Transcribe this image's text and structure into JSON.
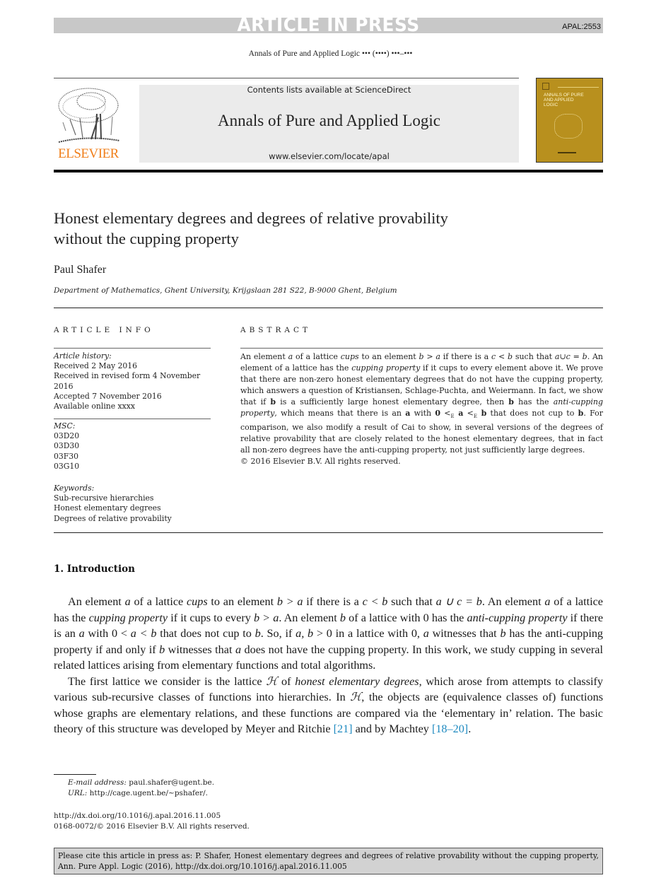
{
  "banner": {
    "title": "ARTICLE IN PRESS",
    "code": "APAL:2553"
  },
  "running_head": "Annals of Pure and Applied Logic ••• (••••) •••–•••",
  "masthead": {
    "publisher": "ELSEVIER",
    "contents": "Contents lists available at ScienceDirect",
    "journal": "Annals of Pure and Applied Logic",
    "url": "www.elsevier.com/locate/apal",
    "cover_text": "ANNALS OF PURE AND APPLIED LOGIC",
    "colors": {
      "publisher_orange": "#f07f1b",
      "cover_gold": "#b8901e"
    }
  },
  "article": {
    "title_line1": "Honest elementary degrees and degrees of relative provability",
    "title_line2": "without the cupping property",
    "author": "Paul Shafer",
    "affiliation": "Department of Mathematics, Ghent University, Krijgslaan 281 S22, B-9000 Ghent, Belgium"
  },
  "info": {
    "heading": "ARTICLE INFO",
    "history_label": "Article history:",
    "history": [
      "Received 2 May 2016",
      "Received in revised form 4 November 2016",
      "Accepted 7 November 2016",
      "Available online xxxx"
    ],
    "msc_label": "MSC:",
    "msc": [
      "03D20",
      "03D30",
      "03F30",
      "03G10"
    ],
    "keywords_label": "Keywords:",
    "keywords": [
      "Sub-recursive hierarchies",
      "Honest elementary degrees",
      "Degrees of relative provability"
    ]
  },
  "abstract": {
    "heading": "ABSTRACT",
    "s1a": "An element ",
    "s1b": "a",
    "s1c": " of a lattice ",
    "s1d": "cups",
    "s1e": " to an element ",
    "s1f": "b > a",
    "s1g": " if there is a ",
    "s1h": "c < b",
    "s1i": " such that ",
    "s1j": "a∪c = b",
    "s1k": ". An element of a lattice has the ",
    "s1l": "cupping property",
    "s1m": " if it cups to every element above it. We prove that there are non-zero honest elementary degrees that do not have the cupping property, which answers a question of Kristiansen, Schlage-Puchta, and Weiermann. In fact, we show that if ",
    "s1n": "b",
    "s1o": " is a sufficiently large honest elementary degree, then ",
    "s1p": "b",
    "s1q": " has the ",
    "s1r": "anti-cupping property",
    "s1s": ", which means that there is an ",
    "s1t": "a",
    "s1u": " with ",
    "s1v": "0",
    "s1w": " <",
    "s1x": "E",
    "s1y": " a",
    "s1z": " <",
    "s2a": "E",
    "s2b": " b",
    "s2c": " that does not cup to ",
    "s2d": "b",
    "s2e": ". For comparison, we also modify a result of Cai to show, in several versions of the degrees of relative provability that are closely related to the honest elementary degrees, that in fact all non-zero degrees have the anti-cupping property, not just sufficiently large degrees.",
    "copyright": "© 2016 Elsevier B.V. All rights reserved."
  },
  "intro": {
    "heading": "1.  Introduction",
    "p1": [
      {
        "t": "An element "
      },
      {
        "t": "a",
        "i": true
      },
      {
        "t": " of a lattice "
      },
      {
        "t": "cups",
        "i": true
      },
      {
        "t": " to an element "
      },
      {
        "t": "b > a",
        "i": true
      },
      {
        "t": " if there is a "
      },
      {
        "t": "c < b",
        "i": true
      },
      {
        "t": " such that "
      },
      {
        "t": "a ∪ c = b",
        "i": true
      },
      {
        "t": ". An element "
      },
      {
        "t": "a",
        "i": true
      },
      {
        "t": " of a lattice has the "
      },
      {
        "t": "cupping property",
        "i": true
      },
      {
        "t": " if it cups to every "
      },
      {
        "t": "b > a",
        "i": true
      },
      {
        "t": ". An element "
      },
      {
        "t": "b",
        "i": true
      },
      {
        "t": " of a lattice with 0 has the "
      },
      {
        "t": "anti-cupping property",
        "i": true
      },
      {
        "t": " if there is an "
      },
      {
        "t": "a",
        "i": true
      },
      {
        "t": " with 0 < "
      },
      {
        "t": "a < b",
        "i": true
      },
      {
        "t": " that does not cup to "
      },
      {
        "t": "b",
        "i": true
      },
      {
        "t": ". So, if "
      },
      {
        "t": "a, b",
        "i": true
      },
      {
        "t": " > 0 in a lattice with 0, "
      },
      {
        "t": "a",
        "i": true
      },
      {
        "t": " witnesses that "
      },
      {
        "t": "b",
        "i": true
      },
      {
        "t": " has the anti-cupping property if and only if "
      },
      {
        "t": "b",
        "i": true
      },
      {
        "t": " witnesses that "
      },
      {
        "t": "a",
        "i": true
      },
      {
        "t": " does not have the cupping property. In this work, we study cupping in several related lattices arising from elementary functions and total algorithms."
      }
    ],
    "p2": [
      {
        "t": "The first lattice we consider is the lattice "
      },
      {
        "t": "ℋ",
        "i": true
      },
      {
        "t": " of "
      },
      {
        "t": "honest elementary degrees",
        "i": true
      },
      {
        "t": ", which arose from attempts to classify various sub-recursive classes of functions into hierarchies. In "
      },
      {
        "t": "ℋ",
        "i": true
      },
      {
        "t": ", the objects are (equivalence classes of) functions whose graphs are elementary relations, and these functions are compared via the ‘elementary in’ relation. The basic theory of this structure was developed by Meyer and Ritchie "
      },
      {
        "t": "[21]",
        "c": true
      },
      {
        "t": " and by Machtey "
      },
      {
        "t": "[18–20]",
        "c": true
      },
      {
        "t": "."
      }
    ]
  },
  "footnote": {
    "email_label": "E-mail address:",
    "email": " paul.shafer@ugent.be.",
    "url_label": "URL:",
    "url": " http://cage.ugent.be/~pshafer/."
  },
  "doi": {
    "link": "http://dx.doi.org/10.1016/j.apal.2016.11.005",
    "issn": "0168-0072/© 2016 Elsevier B.V. All rights reserved."
  },
  "citebox": "Please cite this article in press as: P. Shafer, Honest elementary degrees and degrees of relative provability without the cupping property, Ann. Pure Appl. Logic (2016), http://dx.doi.org/10.1016/j.apal.2016.11.005"
}
